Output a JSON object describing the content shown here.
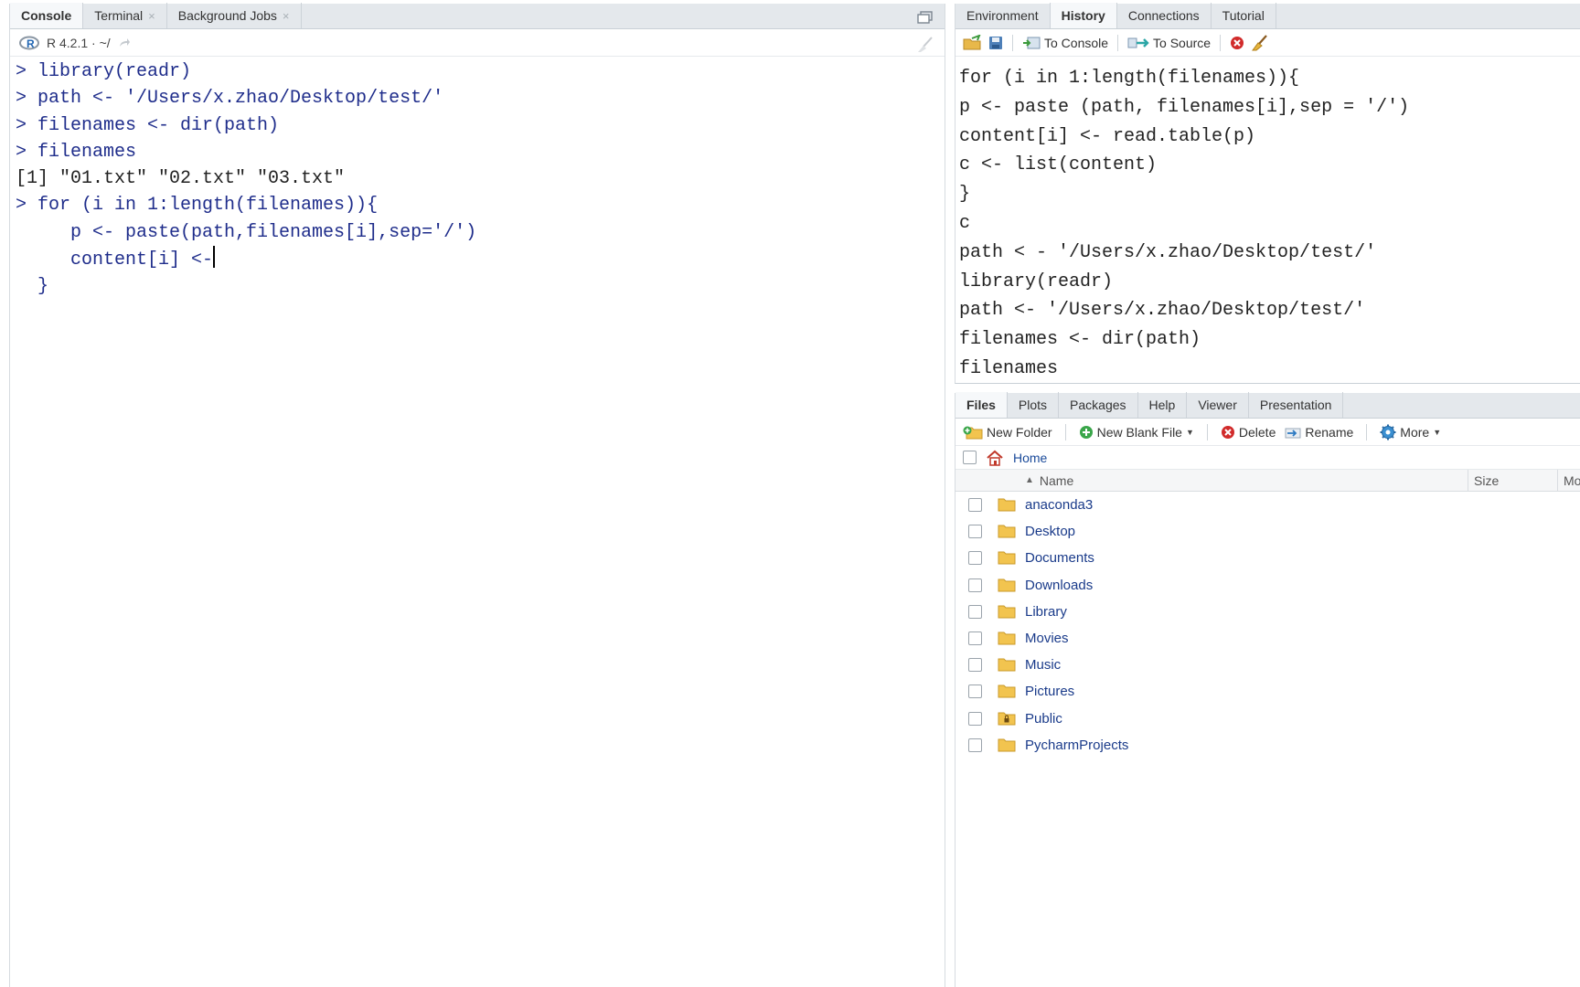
{
  "console_pane": {
    "tabs": [
      {
        "label": "Console"
      },
      {
        "label": "Terminal",
        "close": "×"
      },
      {
        "label": "Background Jobs",
        "close": "×"
      }
    ],
    "r_version": "R 4.2.1 · ~/",
    "lines": [
      "> library(readr)",
      "> path <- '/Users/x.zhao/Desktop/test/'",
      "> filenames <- dir(path)",
      "> filenames",
      "[1] \"01.txt\" \"02.txt\" \"03.txt\"",
      "> for (i in 1:length(filenames)){",
      "     p <- paste(path,filenames[i],sep='/')",
      "     content[i] <-",
      "  }"
    ]
  },
  "environment_pane": {
    "tabs": [
      {
        "label": "Environment"
      },
      {
        "label": "History"
      },
      {
        "label": "Connections"
      },
      {
        "label": "Tutorial"
      }
    ],
    "toolbar": {
      "to_console": "To Console",
      "to_source": "To Source"
    },
    "history_lines": [
      "for (i in 1:length(filenames)){",
      "p <- paste (path, filenames[i],sep = '/')",
      "content[i] <- read.table(p)",
      "c <- list(content)",
      "}",
      "c",
      "path < - '/Users/x.zhao/Desktop/test/'",
      "library(readr)",
      "path <- '/Users/x.zhao/Desktop/test/'",
      "filenames <- dir(path)",
      "filenames"
    ]
  },
  "files_pane": {
    "tabs": [
      {
        "label": "Files"
      },
      {
        "label": "Plots"
      },
      {
        "label": "Packages"
      },
      {
        "label": "Help"
      },
      {
        "label": "Viewer"
      },
      {
        "label": "Presentation"
      }
    ],
    "toolbar": {
      "new_folder": "New Folder",
      "new_blank_file": "New Blank File",
      "delete": "Delete",
      "rename": "Rename",
      "more": "More"
    },
    "path": "Home",
    "columns": {
      "name": "Name",
      "size": "Size",
      "modified": "Mo"
    },
    "files": [
      {
        "name": "anaconda3",
        "icon": "folder-icon"
      },
      {
        "name": "Desktop",
        "icon": "folder-icon"
      },
      {
        "name": "Documents",
        "icon": "folder-icon"
      },
      {
        "name": "Downloads",
        "icon": "folder-icon"
      },
      {
        "name": "Library",
        "icon": "folder-icon"
      },
      {
        "name": "Movies",
        "icon": "folder-icon"
      },
      {
        "name": "Music",
        "icon": "folder-icon"
      },
      {
        "name": "Pictures",
        "icon": "folder-icon"
      },
      {
        "name": "Public",
        "icon": "locked-folder-icon"
      },
      {
        "name": "PycharmProjects",
        "icon": "folder-icon"
      }
    ]
  },
  "colors": {
    "code_blue": "#1f2d8b",
    "tab_bar": "#e4e8ec",
    "folder": "#f2c44f",
    "link": "#1a3b8a"
  }
}
